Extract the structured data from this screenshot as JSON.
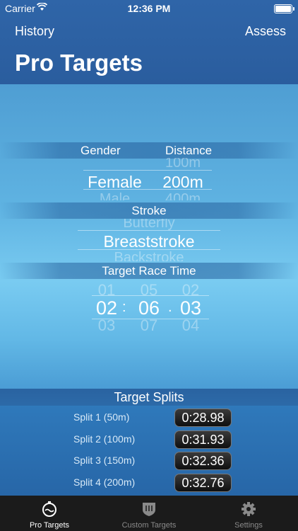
{
  "status_bar": {
    "carrier": "Carrier",
    "time": "12:36 PM"
  },
  "nav": {
    "left": "History",
    "right": "Assess",
    "title": "Pro Targets"
  },
  "sections": {
    "gender_label": "Gender",
    "distance_label": "Distance",
    "stroke_label": "Stroke",
    "target_time_label": "Target Race Time",
    "splits_label": "Target Splits"
  },
  "gender_picker": {
    "above": "",
    "selected": "Female",
    "below": "Male"
  },
  "distance_picker": {
    "above": "100m",
    "selected": "200m",
    "below": "400m"
  },
  "stroke_picker": {
    "above": "Butterfly",
    "selected": "Breaststroke",
    "below": "Backstroke"
  },
  "time_picker": {
    "minutes": {
      "above": "01",
      "selected": "02",
      "below": "03"
    },
    "seconds": {
      "above": "05",
      "selected": "06",
      "below": "07"
    },
    "hundredths": {
      "above": "02",
      "selected": "03",
      "below": "04"
    },
    "sep1": ":",
    "sep2": "."
  },
  "splits": [
    {
      "label": "Split 1 (50m)",
      "value": "0:28.98"
    },
    {
      "label": "Split 2 (100m)",
      "value": "0:31.93"
    },
    {
      "label": "Split 3 (150m)",
      "value": "0:32.36"
    },
    {
      "label": "Split 4 (200m)",
      "value": "0:32.76"
    }
  ],
  "tabs": [
    {
      "label": "Pro Targets",
      "icon": "stopwatch-icon",
      "active": true
    },
    {
      "label": "Custom Targets",
      "icon": "shield-icon",
      "active": false
    },
    {
      "label": "Settings",
      "icon": "gear-icon",
      "active": false
    }
  ],
  "colors": {
    "header": "#2f65a8",
    "tabbar": "#1b1b1b",
    "active_tab": "#ffffff",
    "inactive_tab": "#8a8a8a"
  }
}
